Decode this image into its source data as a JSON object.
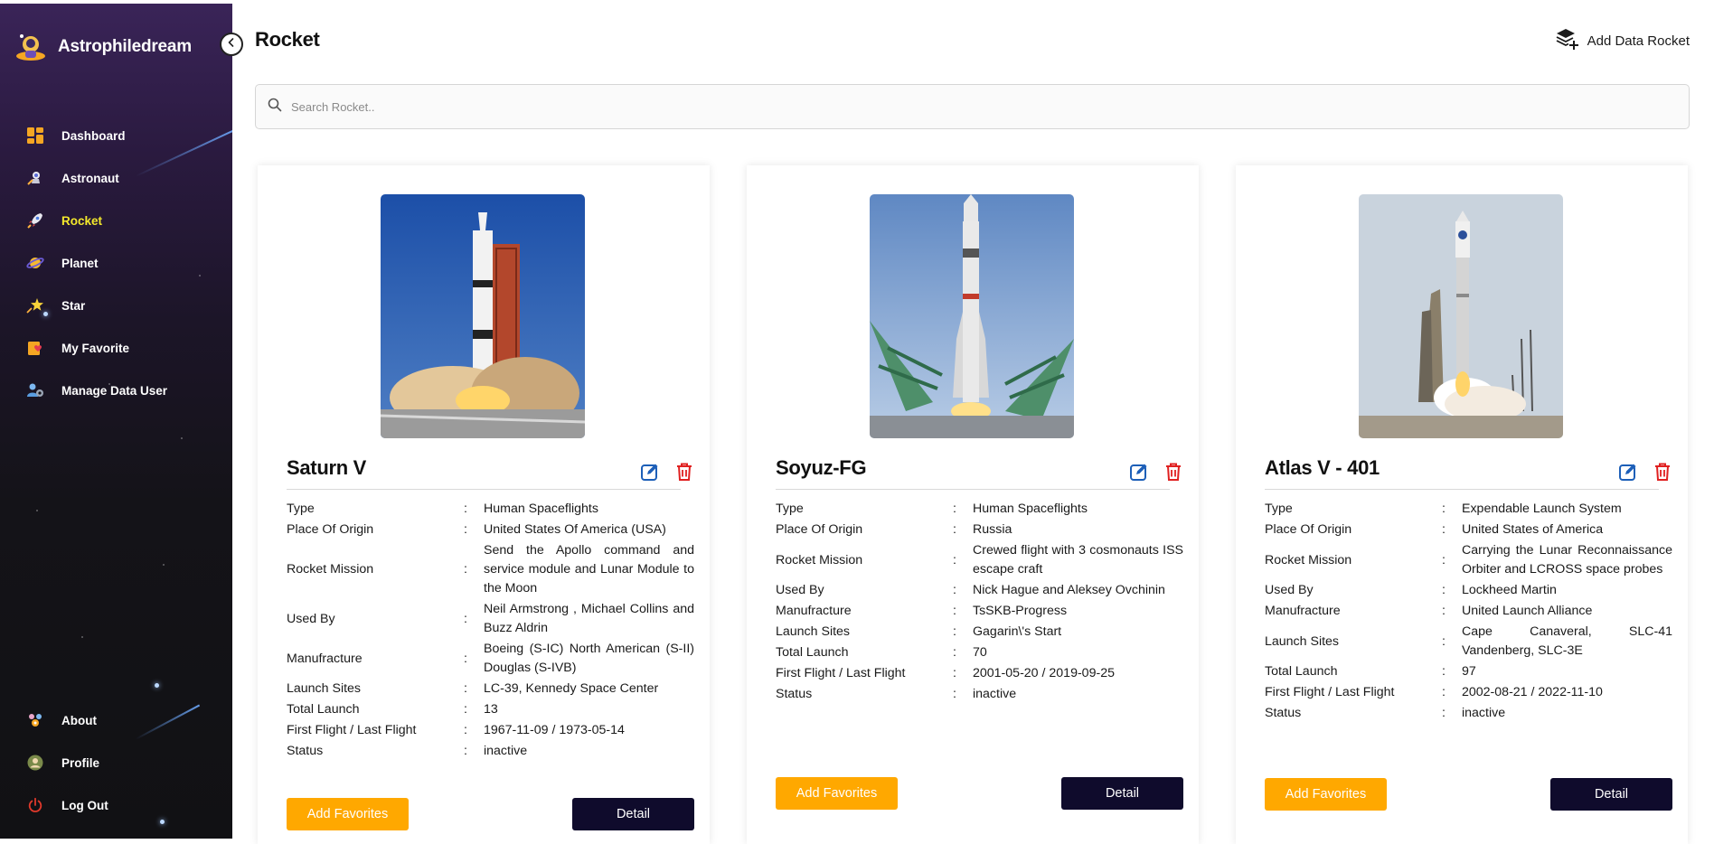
{
  "brand": {
    "name": "Astrophiledream"
  },
  "sidebar": {
    "items": [
      {
        "label": "Dashboard",
        "icon": "dashboard-icon",
        "active": false
      },
      {
        "label": "Astronaut",
        "icon": "astronaut-icon",
        "active": false
      },
      {
        "label": "Rocket",
        "icon": "rocket-icon",
        "active": true
      },
      {
        "label": "Planet",
        "icon": "planet-icon",
        "active": false
      },
      {
        "label": "Star",
        "icon": "star-icon",
        "active": false
      },
      {
        "label": "My Favorite",
        "icon": "favorite-icon",
        "active": false
      },
      {
        "label": "Manage Data User",
        "icon": "manage-users-icon",
        "active": false
      }
    ],
    "bottom_items": [
      {
        "label": "About",
        "icon": "about-icon"
      },
      {
        "label": "Profile",
        "icon": "profile-icon"
      },
      {
        "label": "Log Out",
        "icon": "power-icon"
      }
    ],
    "active_color": "#f4e92c"
  },
  "header": {
    "title": "Rocket",
    "add_label": "Add Data Rocket"
  },
  "search": {
    "placeholder": "Search Rocket.."
  },
  "colors": {
    "favorite_button": "#ffa800",
    "detail_button": "#0f0b2c",
    "delete_icon": "#e02020",
    "edit_icon": "#1d5fb8"
  },
  "labels": {
    "type": "Type",
    "origin": "Place Of Origin",
    "mission": "Rocket Mission",
    "used_by": "Used By",
    "manufacture": "Manufracture",
    "sites": "Launch Sites",
    "total": "Total Launch",
    "flights": "First Flight / Last Flight",
    "status": "Status",
    "separator": ":",
    "favorites_button": "Add Favorites",
    "detail_button": "Detail"
  },
  "rockets": [
    {
      "name": "Saturn V",
      "type": "Human Spaceflights",
      "origin": "United States Of America (USA)",
      "mission": "Send the Apollo command and service module and Lunar Module to the Moon",
      "used_by": "Neil Armstrong , Michael Collins and Buzz Aldrin",
      "manufacture": "Boeing (S-IC) North American (S-II) Douglas (S-IVB)",
      "sites": "LC-39, Kennedy Space Center",
      "total": "13",
      "flights": "1967-11-09 / 1973-05-14",
      "status": "inactive"
    },
    {
      "name": "Soyuz-FG",
      "type": "Human Spaceflights",
      "origin": "Russia",
      "mission": "Crewed flight with 3 cosmonauts ISS escape craft",
      "used_by": "Nick Hague and Aleksey Ovchinin",
      "manufacture": "TsSKB-Progress",
      "sites": "Gagarin\\'s Start",
      "total": "70",
      "flights": "2001-05-20 / 2019-09-25",
      "status": "inactive"
    },
    {
      "name": "Atlas V - 401",
      "type": "Expendable Launch System",
      "origin": "United States of America",
      "mission": "Carrying the Lunar Reconnaissance Orbiter and LCROSS space probes",
      "used_by": "Lockheed Martin",
      "manufacture": "United Launch Alliance",
      "sites": "Cape Canaveral, SLC-41 Vandenberg, SLC-3E",
      "total": "97",
      "flights": "2002-08-21 / 2022-11-10",
      "status": "inactive"
    }
  ]
}
